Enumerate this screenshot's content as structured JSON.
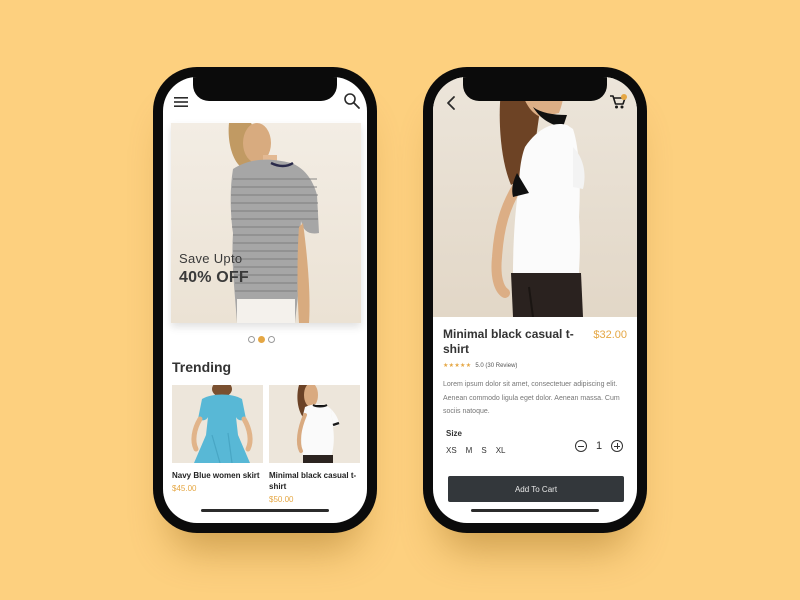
{
  "colors": {
    "background": "#fdd07f",
    "accent": "#e5a744",
    "button": "#33373b"
  },
  "home": {
    "icons": [
      "menu-icon",
      "search-icon"
    ],
    "banner": {
      "subtitle": "Save Upto",
      "headline": "40% OFF"
    },
    "carousel": {
      "count": 3,
      "active_index": 1
    },
    "section_title": "Trending",
    "products": [
      {
        "name": "Navy Blue women skirt",
        "price": "$45.00"
      },
      {
        "name": "Minimal black casual t-shirt",
        "price": "$50.00"
      }
    ]
  },
  "detail": {
    "icons": [
      "back-arrow-icon",
      "cart-icon"
    ],
    "title": "Minimal black casual t-shirt",
    "price": "$32.00",
    "rating": {
      "stars": 5,
      "text": "5.0 (30 Review)"
    },
    "description": "Lorem ipsum dolor sit amet, consectetuer adipiscing elit. Aenean commodo ligula eget dolor. Aenean massa. Cum sociis natoque.",
    "size_label": "Size",
    "sizes": [
      "XS",
      "M",
      "S",
      "XL"
    ],
    "quantity": "1",
    "add_to_cart_label": "Add To Cart"
  }
}
